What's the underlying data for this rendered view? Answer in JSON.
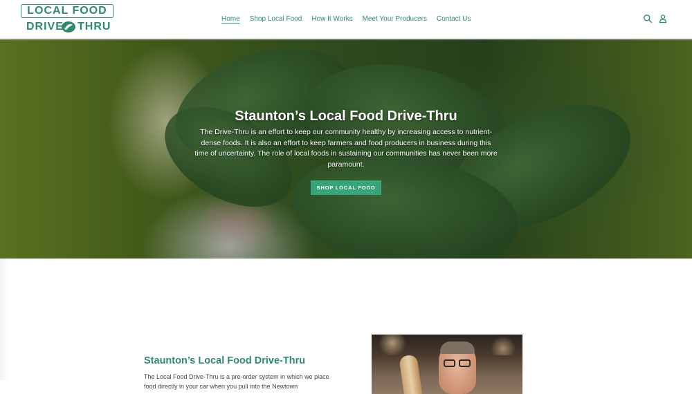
{
  "header": {
    "logo": {
      "line1": "LOCAL FOOD",
      "line2_left": "DRIVE",
      "line2_right": "THRU"
    },
    "nav": [
      {
        "label": "Home",
        "active": true
      },
      {
        "label": "Shop Local Food",
        "active": false
      },
      {
        "label": "How It Works",
        "active": false
      },
      {
        "label": "Meet Your Producers",
        "active": false
      },
      {
        "label": "Contact Us",
        "active": false
      }
    ],
    "icons": {
      "search": "search-icon",
      "account": "account-icon"
    }
  },
  "hero": {
    "title": "Staunton’s Local Food Drive-Thru",
    "text": "The Drive-Thru is an effort to keep our community healthy by increasing access to nutrient-dense foods. It is also an effort to keep farmers and food producers in business during this time of uncertainty. The role of local foods in sustaining our communities has never been more paramount.",
    "button": "SHOP LOCAL FOOD"
  },
  "about": {
    "title": "Staunton’s Local Food Drive-Thru",
    "text": "The Local Food Drive-Thru is a pre-order system in which we place food directly in your car when you pull into the Newtown"
  },
  "colors": {
    "brand": "#2e8b6a",
    "button": "#37a47a"
  }
}
